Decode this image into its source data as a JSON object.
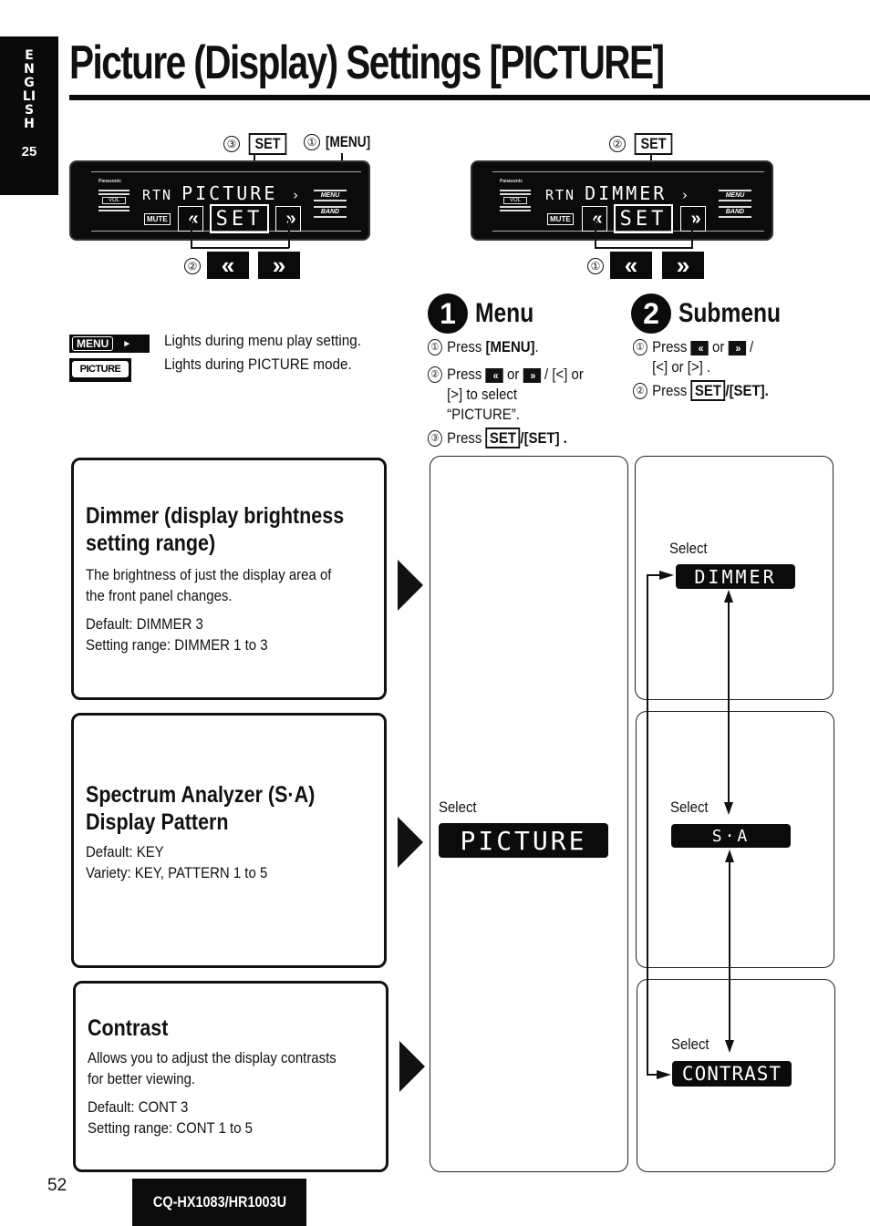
{
  "side_tab": {
    "language": "ENGLISH",
    "section_number": "25"
  },
  "title": "Picture (Display) Settings [PICTURE]",
  "panel_left": {
    "callout_set_num": "③",
    "callout_set_label": "SET",
    "callout_menu_num": "①",
    "callout_menu_label": "[MENU]",
    "callout_arrows_num": "②",
    "brand": "Panasonic",
    "display_prefix": "RTN",
    "display_text": "PICTURE",
    "display_suffix": "›",
    "vol_label": "VOL",
    "mute_label": "MUTE",
    "set_label": "SET",
    "menu_btn_label": "MENU",
    "band_btn_label": "BAND",
    "left_key_icon": "«",
    "right_key_icon": "»"
  },
  "panel_right": {
    "callout_set_num": "②",
    "callout_set_label": "SET",
    "callout_arrows_num": "①",
    "brand": "Panasonic",
    "display_prefix": "RTN",
    "display_text": "DIMMER",
    "display_suffix": "›",
    "vol_label": "VOL",
    "mute_label": "MUTE",
    "set_label": "SET",
    "menu_btn_label": "MENU",
    "band_btn_label": "BAND",
    "left_key_icon": "«",
    "right_key_icon": "»"
  },
  "indicators": [
    {
      "label": "MENU",
      "arrow": "►",
      "description": "Lights during menu play setting."
    },
    {
      "label": "PICTURE",
      "description": "Lights during PICTURE mode."
    }
  ],
  "steps": {
    "menu": {
      "number": "1",
      "title": "Menu",
      "items": [
        {
          "num": "①",
          "pre": "Press ",
          "key": "[MENU]",
          "post": "."
        },
        {
          "num": "②",
          "pre": "Press ",
          "mid": " or ",
          "post": " / [<] or [>] to select “PICTURE”."
        },
        {
          "num": "③",
          "pre": "Press ",
          "box": "SET",
          "post": "/[SET] ."
        }
      ]
    },
    "submenu": {
      "number": "2",
      "title": "Submenu",
      "items": [
        {
          "num": "①",
          "pre": "Press ",
          "mid": " or ",
          "post": " / [<] or [>] ."
        },
        {
          "num": "②",
          "pre": "Press ",
          "box": "SET",
          "post": "/[SET]."
        }
      ]
    }
  },
  "settings": [
    {
      "title": "Dimmer (display brightness setting range)",
      "description": [
        "The brightness of just the display area of",
        "the front panel changes."
      ],
      "details": [
        "Default: DIMMER 3",
        "Setting range: DIMMER 1 to 3"
      ]
    },
    {
      "title": "Spectrum Analyzer (S·A) Display Pattern",
      "description": [],
      "details": [
        "Default: KEY",
        "Variety: KEY, PATTERN 1 to 5"
      ]
    },
    {
      "title": "Contrast",
      "description": [
        "Allows you to adjust the display contrasts",
        "for better viewing."
      ],
      "details": [
        "Default: CONT 3",
        "Setting range: CONT 1 to 5"
      ]
    }
  ],
  "flow": {
    "menu_select_label": "Select",
    "menu_display": "PICTURE",
    "submenu": [
      {
        "select_label": "Select",
        "display": "DIMMER"
      },
      {
        "select_label": "Select",
        "display": "S·A"
      },
      {
        "select_label": "Select",
        "display": "CONTRAST"
      }
    ]
  },
  "footer": {
    "page_number": "52",
    "model": "CQ-HX1083/HR1003U"
  }
}
